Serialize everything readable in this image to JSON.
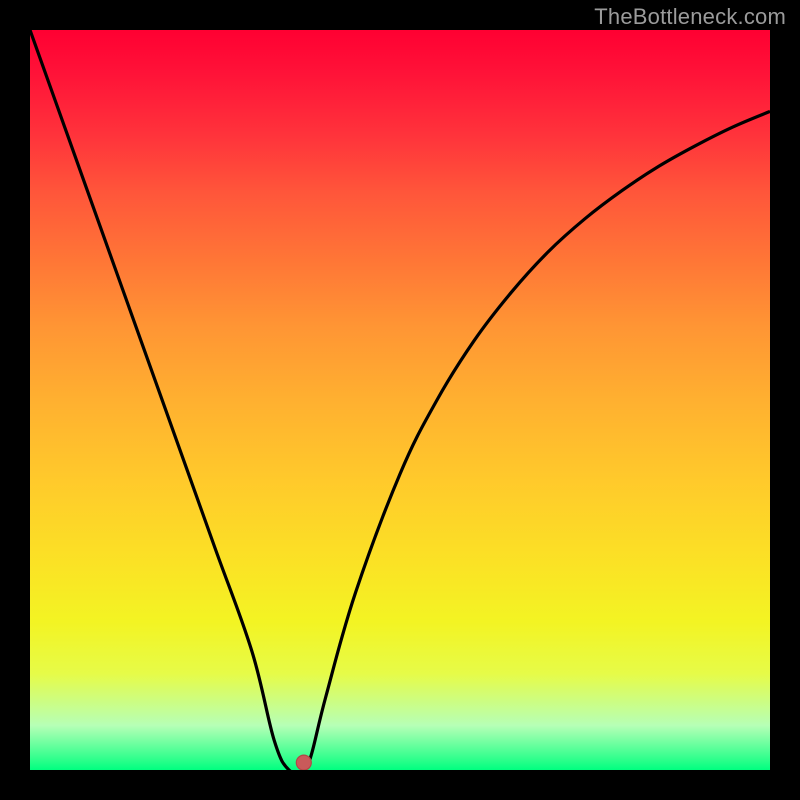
{
  "watermark": "TheBottleneck.com",
  "chart_data": {
    "type": "line",
    "title": "",
    "xlabel": "",
    "ylabel": "",
    "xlim": [
      0,
      100
    ],
    "ylim": [
      0,
      100
    ],
    "grid": false,
    "legend": false,
    "background_gradient": [
      "#ff0032",
      "#ffca2b",
      "#00ff80"
    ],
    "series": [
      {
        "name": "curve",
        "x": [
          0,
          5,
          10,
          15,
          20,
          25,
          30,
          33,
          35,
          37,
          38,
          40,
          44,
          50,
          55,
          60,
          65,
          70,
          75,
          80,
          85,
          90,
          95,
          100
        ],
        "y": [
          100,
          86,
          72,
          58,
          44,
          30,
          16,
          4,
          0,
          0,
          2,
          10,
          24,
          40,
          50,
          58,
          64.5,
          70,
          74.5,
          78.3,
          81.6,
          84.4,
          86.9,
          89
        ]
      }
    ],
    "marker": {
      "x": 37,
      "y": 1,
      "color": "#c95a5a"
    },
    "colors": {
      "curve": "#000000",
      "marker": "#c95a5a",
      "gradient_top": "#ff0032",
      "gradient_mid": "#ffca2b",
      "gradient_bottom": "#00ff80"
    }
  }
}
